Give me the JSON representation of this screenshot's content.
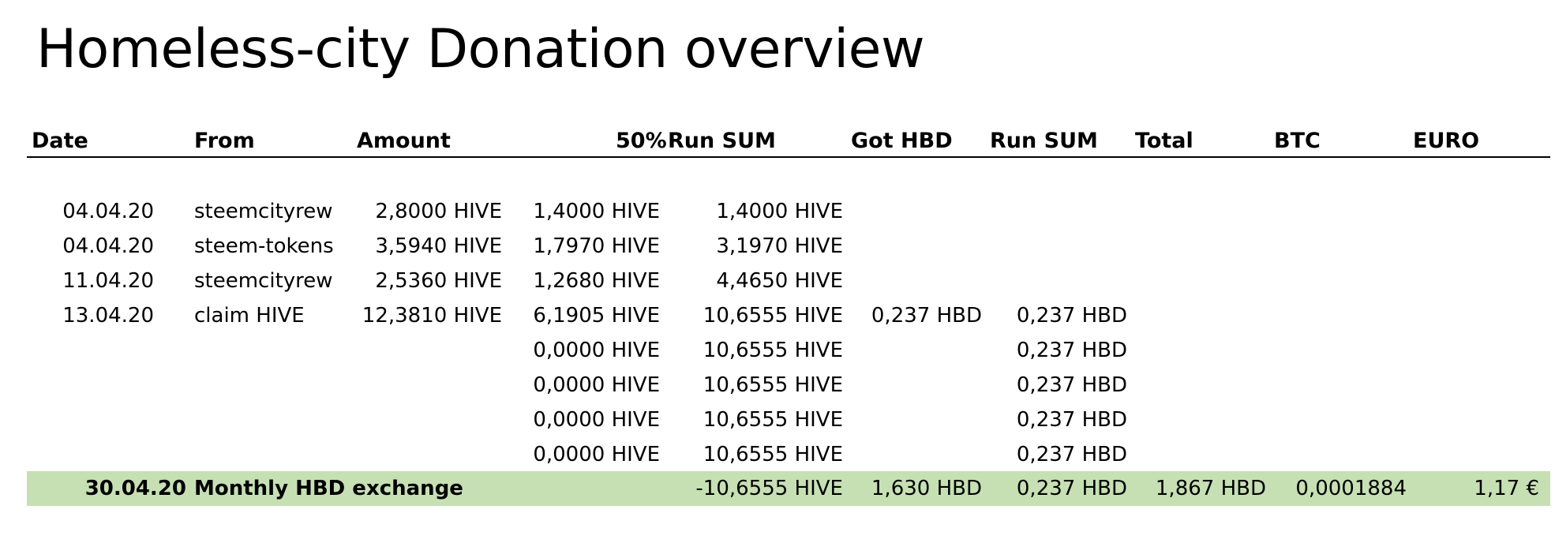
{
  "title": "Homeless-city Donation overview",
  "colors": {
    "summary_background": "#c6e0b4"
  },
  "columns": {
    "date": "Date",
    "from": "From",
    "amount": "Amount",
    "fifty": "50%",
    "runsum": "Run SUM",
    "gothbd": "Got HBD",
    "runsum2": "Run SUM",
    "total": "Total",
    "btc": "BTC",
    "euro": "EURO"
  },
  "rows": [
    {
      "date": "04.04.20",
      "from": "steemcityrew",
      "amount": "2,8000 HIVE",
      "fifty": "1,4000 HIVE",
      "runsum": "1,4000 HIVE",
      "gothbd": "",
      "runsum2": ""
    },
    {
      "date": "04.04.20",
      "from": "steem-tokens",
      "amount": "3,5940 HIVE",
      "fifty": "1,7970 HIVE",
      "runsum": "3,1970 HIVE",
      "gothbd": "",
      "runsum2": ""
    },
    {
      "date": "11.04.20",
      "from": "steemcityrew",
      "amount": "2,5360 HIVE",
      "fifty": "1,2680 HIVE",
      "runsum": "4,4650 HIVE",
      "gothbd": "",
      "runsum2": ""
    },
    {
      "date": "13.04.20",
      "from": "claim HIVE",
      "amount": "12,3810 HIVE",
      "fifty": "6,1905 HIVE",
      "runsum": "10,6555 HIVE",
      "gothbd": "0,237 HBD",
      "runsum2": "0,237 HBD"
    },
    {
      "date": "",
      "from": "",
      "amount": "",
      "fifty": "0,0000 HIVE",
      "runsum": "10,6555 HIVE",
      "gothbd": "",
      "runsum2": "0,237 HBD"
    },
    {
      "date": "",
      "from": "",
      "amount": "",
      "fifty": "0,0000 HIVE",
      "runsum": "10,6555 HIVE",
      "gothbd": "",
      "runsum2": "0,237 HBD"
    },
    {
      "date": "",
      "from": "",
      "amount": "",
      "fifty": "0,0000 HIVE",
      "runsum": "10,6555 HIVE",
      "gothbd": "",
      "runsum2": "0,237 HBD"
    },
    {
      "date": "",
      "from": "",
      "amount": "",
      "fifty": "0,0000 HIVE",
      "runsum": "10,6555 HIVE",
      "gothbd": "",
      "runsum2": "0,237 HBD"
    }
  ],
  "summary": {
    "date": "30.04.20",
    "from": "Monthly HBD exchange",
    "runsum": "-10,6555 HIVE",
    "gothbd": "1,630 HBD",
    "runsum2": "0,237 HBD",
    "total": "1,867 HBD",
    "btc": "0,0001884",
    "euro": "1,17 €"
  }
}
